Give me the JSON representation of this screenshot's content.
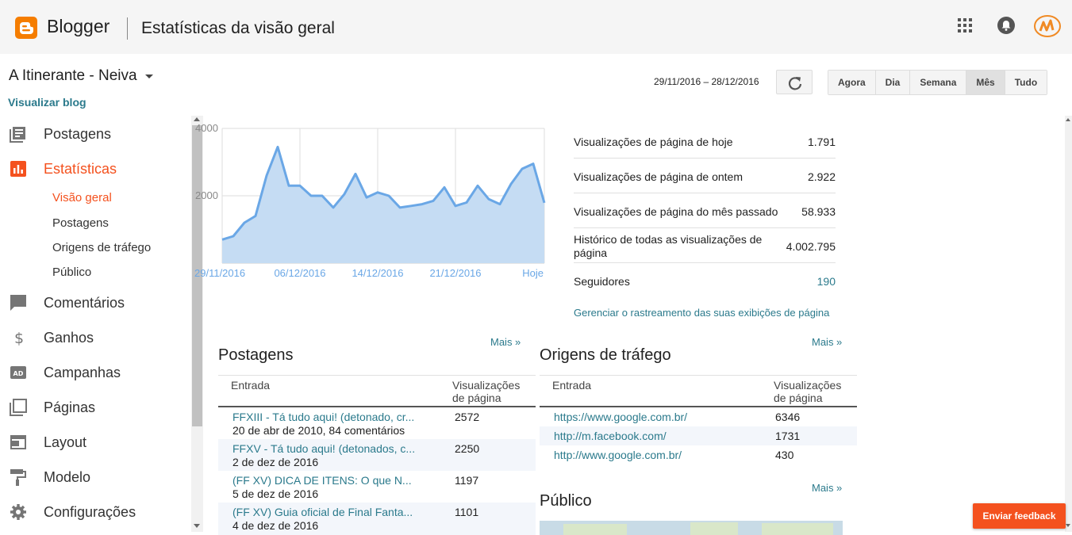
{
  "header": {
    "brand": "Blogger",
    "page_title": "Estatísticas da visão geral",
    "icons": [
      "apps-grid-icon",
      "notifications-bell-icon",
      "user-avatar"
    ]
  },
  "blog": {
    "name": "A Itinerante - Neiva",
    "view_link": "Visualizar blog"
  },
  "toolbar": {
    "date_range": "29/11/2016 – 28/12/2016",
    "periods": [
      "Agora",
      "Dia",
      "Semana",
      "Mês",
      "Tudo"
    ],
    "active_period": "Mês"
  },
  "sidebar": {
    "items": [
      {
        "label": "Postagens",
        "icon": "posts-icon"
      },
      {
        "label": "Estatísticas",
        "icon": "stats-icon",
        "active": true
      },
      {
        "label": "Comentários",
        "icon": "comments-icon"
      },
      {
        "label": "Ganhos",
        "icon": "dollar-icon"
      },
      {
        "label": "Campanhas",
        "icon": "ad-icon"
      },
      {
        "label": "Páginas",
        "icon": "pages-icon"
      },
      {
        "label": "Layout",
        "icon": "layout-icon"
      },
      {
        "label": "Modelo",
        "icon": "paint-roller-icon"
      },
      {
        "label": "Configurações",
        "icon": "gear-icon"
      }
    ],
    "sub_items": [
      "Visão geral",
      "Postagens",
      "Origens de tráfego",
      "Público"
    ]
  },
  "chart_data": {
    "type": "area",
    "x_ticks": [
      "29/11/2016",
      "06/12/2016",
      "14/12/2016",
      "21/12/2016",
      "Hoje"
    ],
    "y_ticks": [
      "4000",
      "2000"
    ],
    "ylim": [
      0,
      4000
    ],
    "x": [
      "29/11",
      "30/11",
      "01/12",
      "02/12",
      "03/12",
      "04/12",
      "05/12",
      "06/12",
      "07/12",
      "08/12",
      "09/12",
      "10/12",
      "11/12",
      "12/12",
      "13/12",
      "14/12",
      "15/12",
      "16/12",
      "17/12",
      "18/12",
      "19/12",
      "20/12",
      "21/12",
      "22/12",
      "23/12",
      "24/12",
      "25/12",
      "26/12",
      "27/12",
      "28/12"
    ],
    "values": [
      700,
      800,
      1200,
      1400,
      2600,
      3450,
      2300,
      2300,
      2000,
      2000,
      1650,
      2050,
      2650,
      1950,
      2100,
      2000,
      1650,
      1700,
      1750,
      1850,
      2250,
      1700,
      1800,
      2300,
      1900,
      1750,
      2350,
      2800,
      2950,
      1791
    ],
    "color": "#6aa7e6",
    "fill": "#c5dcf3"
  },
  "stats": [
    {
      "label": "Visualizações de página de hoje",
      "value": "1.791"
    },
    {
      "label": "Visualizações de página de ontem",
      "value": "2.922"
    },
    {
      "label": "Visualizações de página do mês passado",
      "value": "58.933"
    },
    {
      "label": "Histórico de todas as visualizações de página",
      "value": "4.002.795"
    },
    {
      "label": "Seguidores",
      "value": "190"
    }
  ],
  "manage_link": "Gerenciar o rastreamento das suas exibições de página",
  "more_label": "Mais »",
  "posts": {
    "title": "Postagens",
    "col_entry": "Entrada",
    "col_views": "Visualizações de página",
    "rows": [
      {
        "title": "FFXIII - Tá tudo aqui! (detonado, cr...",
        "meta": "20 de abr de 2010, 84 comentários",
        "views": "2572"
      },
      {
        "title": "FFXV - Tá tudo aqui! (detonados, c...",
        "meta": "2 de dez de 2016",
        "views": "2250"
      },
      {
        "title": "(FF XV) DICA DE ITENS: O que N...",
        "meta": "5 de dez de 2016",
        "views": "1197"
      },
      {
        "title": "(FF XV) Guia oficial de Final Fanta...",
        "meta": "4 de dez de 2016",
        "views": "1101"
      }
    ]
  },
  "traffic": {
    "title": "Origens de tráfego",
    "col_entry": "Entrada",
    "col_views": "Visualizações de página",
    "rows": [
      {
        "url": "https://www.google.com.br/",
        "views": "6346"
      },
      {
        "url": "http://m.facebook.com/",
        "views": "1731"
      },
      {
        "url": "http://www.google.com.br/",
        "views": "430"
      }
    ]
  },
  "audience": {
    "title": "Público"
  },
  "feedback_button": "Enviar feedback",
  "colors": {
    "accent": "#f4511e",
    "link": "#2b7a8c",
    "brand": "#f57d00"
  }
}
